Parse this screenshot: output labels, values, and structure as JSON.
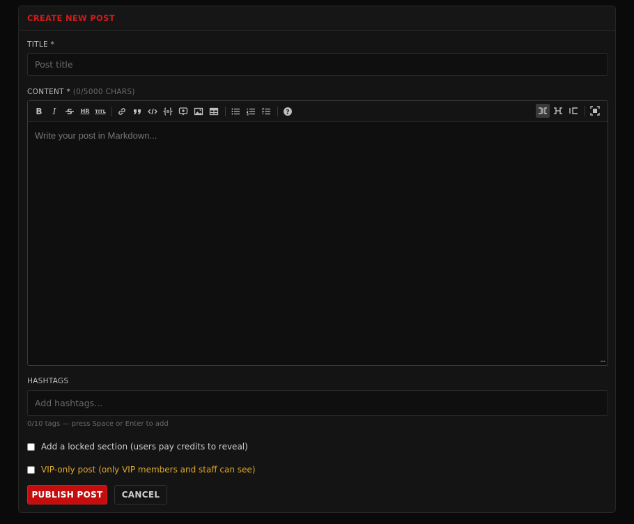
{
  "card": {
    "title": "CREATE NEW POST"
  },
  "title_field": {
    "label": "TITLE *",
    "placeholder": "Post title"
  },
  "content_field": {
    "label": "CONTENT *",
    "hint": "(0/5000 CHARS)",
    "placeholder": "Write your post in Markdown...",
    "resize_handle": "..."
  },
  "toolbar": {
    "left_icons": [
      "bold-icon",
      "italic-icon",
      "strikethrough-icon",
      "heading-icon",
      "heading-smaller-icon",
      "link-icon",
      "quote-icon",
      "code-icon",
      "code-block-icon",
      "clean-block-icon",
      "image-icon",
      "table-icon",
      "unordered-list-icon",
      "ordered-list-icon",
      "checklist-icon",
      "help-icon"
    ],
    "right_icons": [
      "side-by-side-icon",
      "preview-icon",
      "editor-only-icon",
      "fullscreen-icon"
    ],
    "labels": {
      "bold": "B",
      "italic": "I",
      "hr": "HR",
      "title": "TITL",
      "help": "?"
    }
  },
  "hashtags_field": {
    "label": "HASHTAGS",
    "placeholder": "Add hashtags...",
    "help": "0/10 tags — press Space or Enter to add"
  },
  "options": {
    "locked": "Add a locked section (users pay credits to reveal)",
    "vip": "VIP-only post (only VIP members and staff can see)"
  },
  "colors": {
    "accent": "#c60d0d",
    "vip_text": "#e0a92a",
    "title_red": "#d11b1b"
  },
  "actions": {
    "publish": "PUBLISH POST",
    "cancel": "CANCEL"
  }
}
